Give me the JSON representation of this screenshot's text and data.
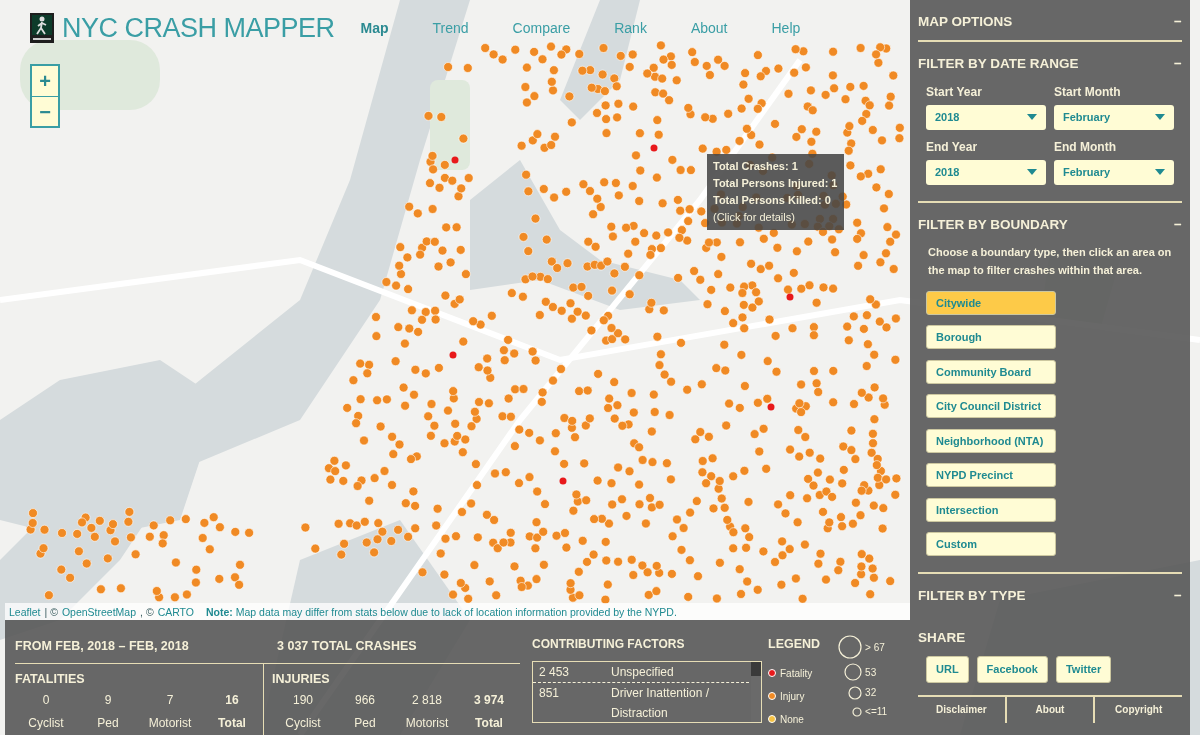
{
  "header": {
    "title": "NYC CRASH MAPPER",
    "nav": [
      {
        "label": "Map",
        "selected": true
      },
      {
        "label": "Trend",
        "selected": false
      },
      {
        "label": "Compare",
        "selected": false
      },
      {
        "label": "Rank",
        "selected": false
      },
      {
        "label": "About",
        "selected": false
      },
      {
        "label": "Help",
        "selected": false
      }
    ]
  },
  "zoom_controls": [
    "+",
    "−"
  ],
  "tooltip": [
    "Total Crashes: 1",
    "Total Persons Injured: 1",
    "Total Persons Killed: 0",
    "(Click for details)"
  ],
  "attribution": {
    "parts": [
      {
        "kind": "link",
        "text": "Leaflet"
      },
      {
        "kind": "text",
        "text": "| ©"
      },
      {
        "kind": "link",
        "text": "OpenStreetMap"
      },
      {
        "kind": "text",
        "text": ", ©"
      },
      {
        "kind": "link",
        "text": "CARTO"
      }
    ],
    "note": "**Note:** Map data may differ from stats below due to lack of location information provided by the NYPD."
  },
  "sidebar": {
    "title": "MAP OPTIONS",
    "toggle": "−",
    "date_range": {
      "title": "FILTER BY DATE RANGE",
      "toggle": "−",
      "fields": [
        {
          "label": "Start Year",
          "value": "2018"
        },
        {
          "label": "Start Month",
          "value": "February"
        },
        {
          "label": "End Year",
          "value": "2018"
        },
        {
          "label": "End Month",
          "value": "February"
        }
      ]
    },
    "boundary": {
      "title": "FILTER BY BOUNDARY",
      "toggle": "−",
      "description": "Choose a boundary type, then click an area on the map to filter crashes within that area.",
      "options": [
        {
          "label": "Citywide",
          "selected": true
        },
        {
          "label": "Borough",
          "selected": false
        },
        {
          "label": "Community Board",
          "selected": false
        },
        {
          "label": "City Council District",
          "selected": false
        },
        {
          "label": "Neighborhood (NTA)",
          "selected": false
        },
        {
          "label": "NYPD Precinct",
          "selected": false
        },
        {
          "label": "Intersection",
          "selected": false
        },
        {
          "label": "Custom",
          "selected": false
        }
      ]
    },
    "type_filter": {
      "title": "FILTER BY TYPE",
      "toggle": "−"
    },
    "share": {
      "title": "SHARE",
      "buttons": [
        "URL",
        "Facebook",
        "Twitter"
      ]
    },
    "footer_links": [
      "Disclaimer",
      "About",
      "Copyright"
    ]
  },
  "stats": {
    "range": "FROM FEB, 2018 – FEB, 2018",
    "total_crashes": "3 037 TOTAL CRASHES",
    "groups": [
      {
        "title": "FATALITIES",
        "items": [
          {
            "value": "0",
            "label": "Cyclist",
            "total": false
          },
          {
            "value": "9",
            "label": "Ped",
            "total": false
          },
          {
            "value": "7",
            "label": "Motorist",
            "total": false
          },
          {
            "value": "16",
            "label": "Total",
            "total": true
          }
        ]
      },
      {
        "title": "INJURIES",
        "items": [
          {
            "value": "190",
            "label": "Cyclist",
            "total": false
          },
          {
            "value": "966",
            "label": "Ped",
            "total": false
          },
          {
            "value": "2 818",
            "label": "Motorist",
            "total": false
          },
          {
            "value": "3 974",
            "label": "Total",
            "total": true
          }
        ]
      }
    ]
  },
  "factors": {
    "title": "CONTRIBUTING FACTORS",
    "rows": [
      {
        "count": "2 453",
        "factor": "Unspecified"
      },
      {
        "count": "851",
        "factor": "Driver Inattention / Distraction"
      }
    ]
  },
  "legend": {
    "title": "LEGEND",
    "items": [
      {
        "label": "Fatality",
        "color": "#e8191b"
      },
      {
        "label": "Injury",
        "color": "#f08a24"
      },
      {
        "label": "None",
        "color": "#f5c143"
      }
    ],
    "sizes": [
      "> 67",
      "53",
      "32",
      "<=11"
    ]
  }
}
